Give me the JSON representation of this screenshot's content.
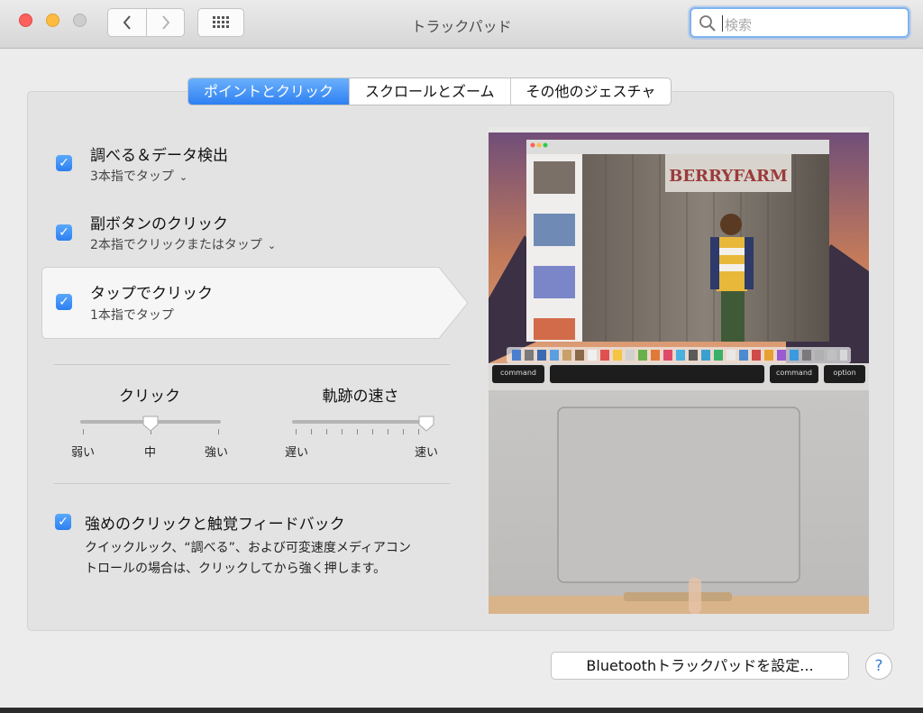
{
  "window": {
    "title": "トラックパッド"
  },
  "search": {
    "placeholder": "検索"
  },
  "tabs": [
    {
      "label": "ポイントとクリック",
      "selected": true
    },
    {
      "label": "スクロールとズーム",
      "selected": false
    },
    {
      "label": "その他のジェスチャ",
      "selected": false
    }
  ],
  "options": [
    {
      "title": "調べる＆データ検出",
      "subtitle": "3本指でタップ",
      "checked": true,
      "has_dropdown": true
    },
    {
      "title": "副ボタンのクリック",
      "subtitle": "2本指でクリックまたはタップ",
      "checked": true,
      "has_dropdown": true
    },
    {
      "title": "タップでクリック",
      "subtitle": "1本指でタップ",
      "checked": true,
      "has_dropdown": false,
      "selected": true
    }
  ],
  "sliders": {
    "click": {
      "label": "クリック",
      "min_label": "弱い",
      "mid_label": "中",
      "max_label": "強い",
      "value_fraction": 0.5
    },
    "tracking": {
      "label": "軌跡の速さ",
      "min_label": "遅い",
      "max_label": "速い",
      "value_fraction": 1.0
    }
  },
  "force_click": {
    "title": "強めのクリックと触覚フィードバック",
    "checked": true,
    "description_line1": "クイックルック、“調べる”、および可変速度メディアコン",
    "description_line2": "トロールの場合は、クリックしてから強く押します。"
  },
  "buttons": {
    "bluetooth": "Bluetoothトラックパッドを設定...",
    "help": "?"
  },
  "preview": {
    "banner_text": "BERRYFARM",
    "key_left": "command",
    "key_right1": "command",
    "key_right2": "option"
  },
  "colors": {
    "accent": "#2e80f2",
    "panel": "#e3e3e3",
    "window": "#ececec"
  }
}
